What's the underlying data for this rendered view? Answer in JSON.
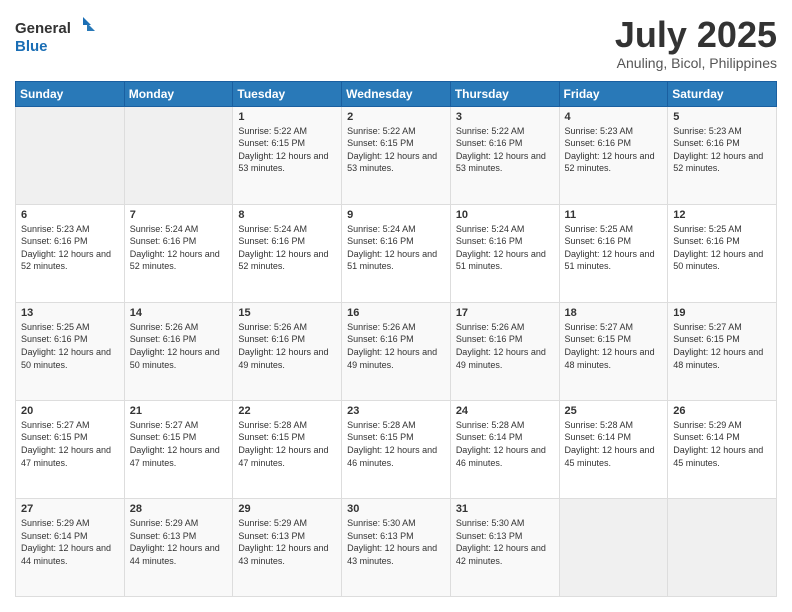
{
  "logo": {
    "line1": "General",
    "line2": "Blue"
  },
  "title": "July 2025",
  "subtitle": "Anuling, Bicol, Philippines",
  "days_of_week": [
    "Sunday",
    "Monday",
    "Tuesday",
    "Wednesday",
    "Thursday",
    "Friday",
    "Saturday"
  ],
  "weeks": [
    [
      {
        "day": "",
        "info": ""
      },
      {
        "day": "",
        "info": ""
      },
      {
        "day": "1",
        "info": "Sunrise: 5:22 AM\nSunset: 6:15 PM\nDaylight: 12 hours and 53 minutes."
      },
      {
        "day": "2",
        "info": "Sunrise: 5:22 AM\nSunset: 6:15 PM\nDaylight: 12 hours and 53 minutes."
      },
      {
        "day": "3",
        "info": "Sunrise: 5:22 AM\nSunset: 6:16 PM\nDaylight: 12 hours and 53 minutes."
      },
      {
        "day": "4",
        "info": "Sunrise: 5:23 AM\nSunset: 6:16 PM\nDaylight: 12 hours and 52 minutes."
      },
      {
        "day": "5",
        "info": "Sunrise: 5:23 AM\nSunset: 6:16 PM\nDaylight: 12 hours and 52 minutes."
      }
    ],
    [
      {
        "day": "6",
        "info": "Sunrise: 5:23 AM\nSunset: 6:16 PM\nDaylight: 12 hours and 52 minutes."
      },
      {
        "day": "7",
        "info": "Sunrise: 5:24 AM\nSunset: 6:16 PM\nDaylight: 12 hours and 52 minutes."
      },
      {
        "day": "8",
        "info": "Sunrise: 5:24 AM\nSunset: 6:16 PM\nDaylight: 12 hours and 52 minutes."
      },
      {
        "day": "9",
        "info": "Sunrise: 5:24 AM\nSunset: 6:16 PM\nDaylight: 12 hours and 51 minutes."
      },
      {
        "day": "10",
        "info": "Sunrise: 5:24 AM\nSunset: 6:16 PM\nDaylight: 12 hours and 51 minutes."
      },
      {
        "day": "11",
        "info": "Sunrise: 5:25 AM\nSunset: 6:16 PM\nDaylight: 12 hours and 51 minutes."
      },
      {
        "day": "12",
        "info": "Sunrise: 5:25 AM\nSunset: 6:16 PM\nDaylight: 12 hours and 50 minutes."
      }
    ],
    [
      {
        "day": "13",
        "info": "Sunrise: 5:25 AM\nSunset: 6:16 PM\nDaylight: 12 hours and 50 minutes."
      },
      {
        "day": "14",
        "info": "Sunrise: 5:26 AM\nSunset: 6:16 PM\nDaylight: 12 hours and 50 minutes."
      },
      {
        "day": "15",
        "info": "Sunrise: 5:26 AM\nSunset: 6:16 PM\nDaylight: 12 hours and 49 minutes."
      },
      {
        "day": "16",
        "info": "Sunrise: 5:26 AM\nSunset: 6:16 PM\nDaylight: 12 hours and 49 minutes."
      },
      {
        "day": "17",
        "info": "Sunrise: 5:26 AM\nSunset: 6:16 PM\nDaylight: 12 hours and 49 minutes."
      },
      {
        "day": "18",
        "info": "Sunrise: 5:27 AM\nSunset: 6:15 PM\nDaylight: 12 hours and 48 minutes."
      },
      {
        "day": "19",
        "info": "Sunrise: 5:27 AM\nSunset: 6:15 PM\nDaylight: 12 hours and 48 minutes."
      }
    ],
    [
      {
        "day": "20",
        "info": "Sunrise: 5:27 AM\nSunset: 6:15 PM\nDaylight: 12 hours and 47 minutes."
      },
      {
        "day": "21",
        "info": "Sunrise: 5:27 AM\nSunset: 6:15 PM\nDaylight: 12 hours and 47 minutes."
      },
      {
        "day": "22",
        "info": "Sunrise: 5:28 AM\nSunset: 6:15 PM\nDaylight: 12 hours and 47 minutes."
      },
      {
        "day": "23",
        "info": "Sunrise: 5:28 AM\nSunset: 6:15 PM\nDaylight: 12 hours and 46 minutes."
      },
      {
        "day": "24",
        "info": "Sunrise: 5:28 AM\nSunset: 6:14 PM\nDaylight: 12 hours and 46 minutes."
      },
      {
        "day": "25",
        "info": "Sunrise: 5:28 AM\nSunset: 6:14 PM\nDaylight: 12 hours and 45 minutes."
      },
      {
        "day": "26",
        "info": "Sunrise: 5:29 AM\nSunset: 6:14 PM\nDaylight: 12 hours and 45 minutes."
      }
    ],
    [
      {
        "day": "27",
        "info": "Sunrise: 5:29 AM\nSunset: 6:14 PM\nDaylight: 12 hours and 44 minutes."
      },
      {
        "day": "28",
        "info": "Sunrise: 5:29 AM\nSunset: 6:13 PM\nDaylight: 12 hours and 44 minutes."
      },
      {
        "day": "29",
        "info": "Sunrise: 5:29 AM\nSunset: 6:13 PM\nDaylight: 12 hours and 43 minutes."
      },
      {
        "day": "30",
        "info": "Sunrise: 5:30 AM\nSunset: 6:13 PM\nDaylight: 12 hours and 43 minutes."
      },
      {
        "day": "31",
        "info": "Sunrise: 5:30 AM\nSunset: 6:13 PM\nDaylight: 12 hours and 42 minutes."
      },
      {
        "day": "",
        "info": ""
      },
      {
        "day": "",
        "info": ""
      }
    ]
  ]
}
